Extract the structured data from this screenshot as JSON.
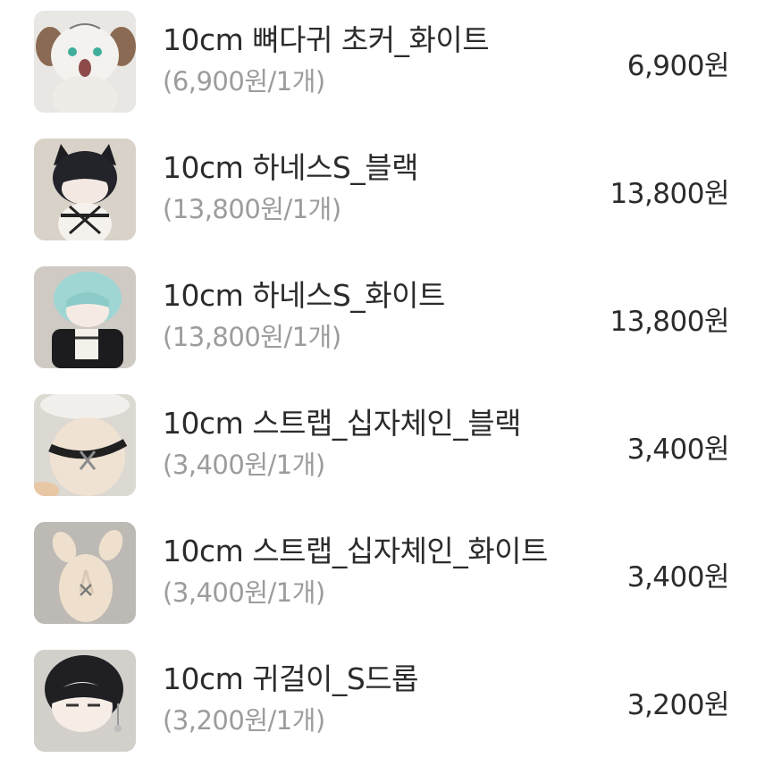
{
  "items": [
    {
      "name": "10cm 뼈다귀 초커_화이트",
      "unit_price": "(6,900원/1개)",
      "total": "6,900원"
    },
    {
      "name": "10cm 하네스S_블랙",
      "unit_price": "(13,800원/1개)",
      "total": "13,800원"
    },
    {
      "name": "10cm 하네스S_화이트",
      "unit_price": "(13,800원/1개)",
      "total": "13,800원"
    },
    {
      "name": "10cm 스트랩_십자체인_블랙",
      "unit_price": "(3,400원/1개)",
      "total": "3,400원"
    },
    {
      "name": "10cm 스트랩_십자체인_화이트",
      "unit_price": "(3,400원/1개)",
      "total": "3,400원"
    },
    {
      "name": "10cm 귀걸이_S드롭",
      "unit_price": "(3,200원/1개)",
      "total": "3,200원"
    }
  ]
}
